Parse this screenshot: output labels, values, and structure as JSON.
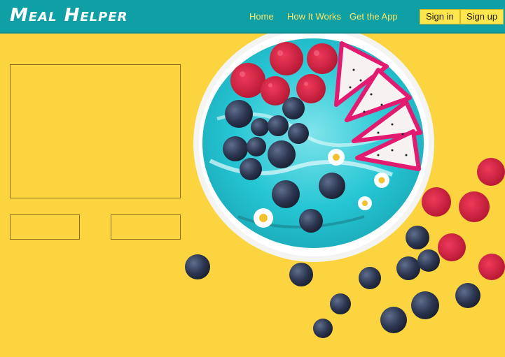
{
  "brand": {
    "name": "Meal Helper"
  },
  "nav": {
    "links": [
      "Home",
      "How It Works",
      "Get the App"
    ],
    "sign_in": "Sign in",
    "sign_up": "Sign up"
  },
  "colors": {
    "navbar": "#0fa0a6",
    "background": "#fcd43f",
    "nav_link": "#fde566",
    "button": "#fde74c"
  },
  "hero": {
    "image": "smoothie-bowl-photo"
  }
}
